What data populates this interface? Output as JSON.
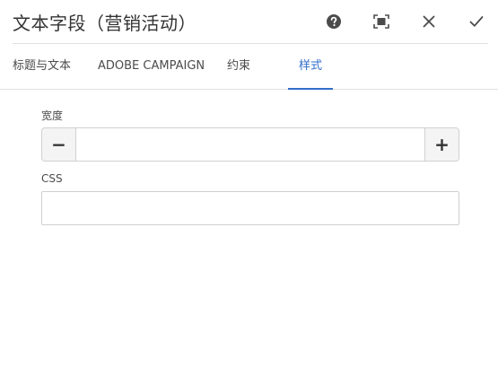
{
  "dialog": {
    "title": "文本字段（营销活动）",
    "actions": [
      {
        "icon": "help-icon"
      },
      {
        "icon": "fullscreen-icon"
      },
      {
        "icon": "close-icon"
      },
      {
        "icon": "checkmark-icon"
      }
    ]
  },
  "tabs": [
    {
      "label": "标题与文本",
      "active": false
    },
    {
      "label": "ADOBE CAMPAIGN",
      "active": false
    },
    {
      "label": "约束",
      "active": false
    },
    {
      "label": "样式",
      "active": true
    }
  ],
  "fields": {
    "width": {
      "label": "宽度",
      "value": "",
      "decrement_label": "−",
      "increment_label": "+"
    },
    "css": {
      "label": "CSS",
      "value": ""
    }
  },
  "colors": {
    "accent": "#326ec8",
    "text": "#323232",
    "border": "#d0d0d0"
  }
}
